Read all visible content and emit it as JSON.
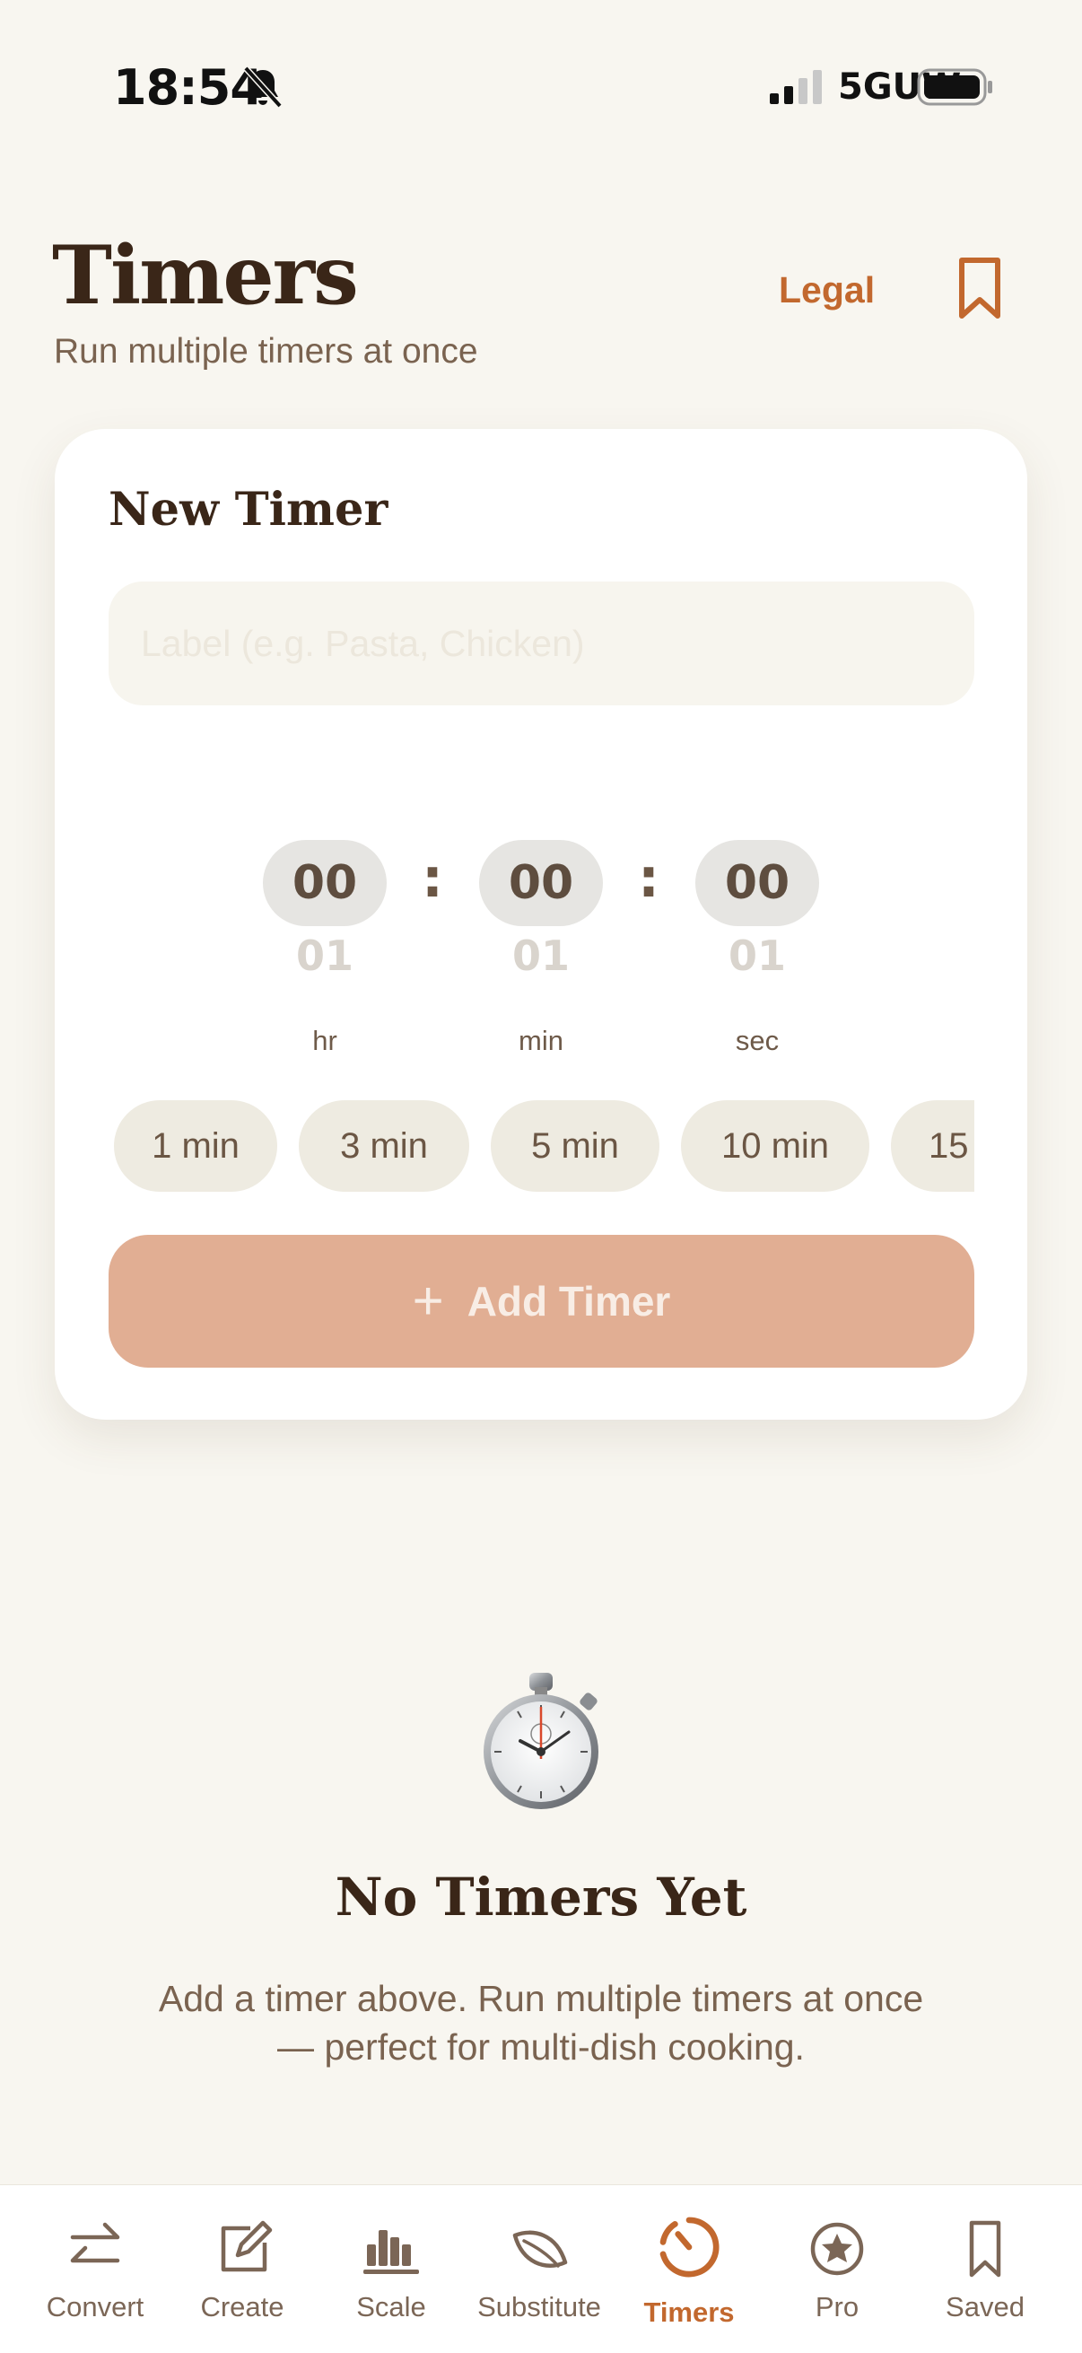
{
  "status_bar": {
    "time": "18:54",
    "network": "5GUW"
  },
  "header": {
    "title": "Timers",
    "subtitle": "Run multiple timers at once",
    "legal_label": "Legal"
  },
  "new_timer": {
    "title": "New Timer",
    "label_placeholder": "Label (e.g. Pasta, Chicken)",
    "hours": {
      "value": "00",
      "next": "01",
      "unit": "hr"
    },
    "minutes": {
      "value": "00",
      "next": "01",
      "unit": "min"
    },
    "seconds": {
      "value": "00",
      "next": "01",
      "unit": "sec"
    },
    "separator": ":",
    "presets": [
      "1 min",
      "3 min",
      "5 min",
      "10 min",
      "15"
    ],
    "add_button_label": "Add Timer",
    "add_button_icon": "+"
  },
  "empty_state": {
    "title": "No Timers Yet",
    "description": "Add a timer above. Run multiple timers at once — perfect for multi-dish cooking."
  },
  "tab_bar": {
    "tabs": [
      {
        "label": "Convert",
        "icon": "arrows-swap-icon"
      },
      {
        "label": "Create",
        "icon": "edit-icon"
      },
      {
        "label": "Scale",
        "icon": "bar-chart-icon"
      },
      {
        "label": "Substitute",
        "icon": "leaf-icon"
      },
      {
        "label": "Timers",
        "icon": "timer-icon",
        "active": true
      },
      {
        "label": "Pro",
        "icon": "star-icon"
      },
      {
        "label": "Saved",
        "icon": "bookmark-icon"
      }
    ]
  },
  "colors": {
    "accent": "#c2682e",
    "background": "#f8f6f0",
    "button_disabled": "#e1ae93"
  }
}
